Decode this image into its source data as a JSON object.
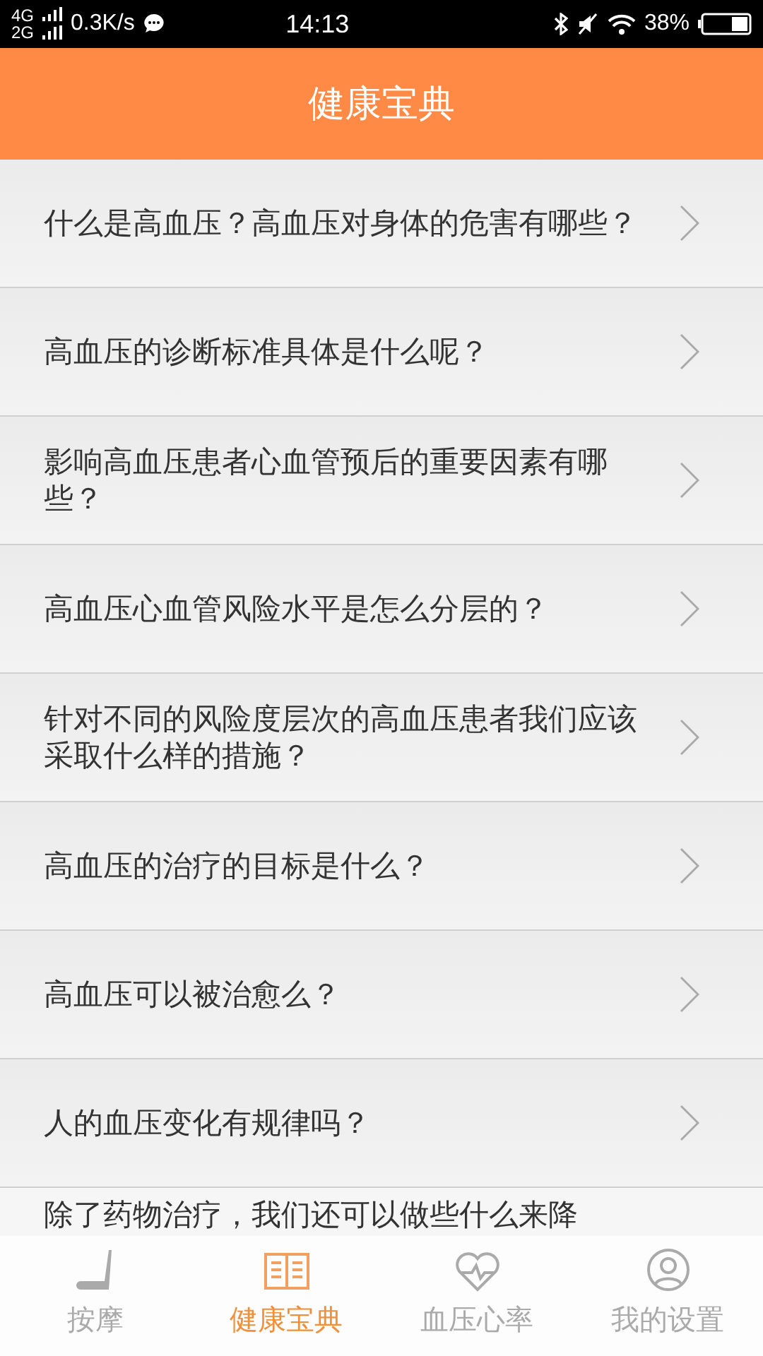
{
  "status_bar": {
    "network_top": "4G",
    "network_bottom": "2G",
    "speed": "0.3K/s",
    "time": "14:13",
    "battery": "38%"
  },
  "header": {
    "title": "健康宝典"
  },
  "articles": [
    {
      "title": "什么是高血压？高血压对身体的危害有哪些？"
    },
    {
      "title": "高血压的诊断标准具体是什么呢？"
    },
    {
      "title": "影响高血压患者心血管预后的重要因素有哪些？"
    },
    {
      "title": "高血压心血管风险水平是怎么分层的？"
    },
    {
      "title": "针对不同的风险度层次的高血压患者我们应该采取什么样的措施？"
    },
    {
      "title": "高血压的治疗的目标是什么？"
    },
    {
      "title": "高血压可以被治愈么？"
    },
    {
      "title": "人的血压变化有规律吗？"
    },
    {
      "title": "除了药物治疗，我们还可以做些什么来降"
    }
  ],
  "tabs": [
    {
      "label": "按摩",
      "kind": "massage",
      "selected": false
    },
    {
      "label": "健康宝典",
      "kind": "book",
      "selected": true
    },
    {
      "label": "血压心率",
      "kind": "heart",
      "selected": false
    },
    {
      "label": "我的设置",
      "kind": "user",
      "selected": false
    }
  ]
}
